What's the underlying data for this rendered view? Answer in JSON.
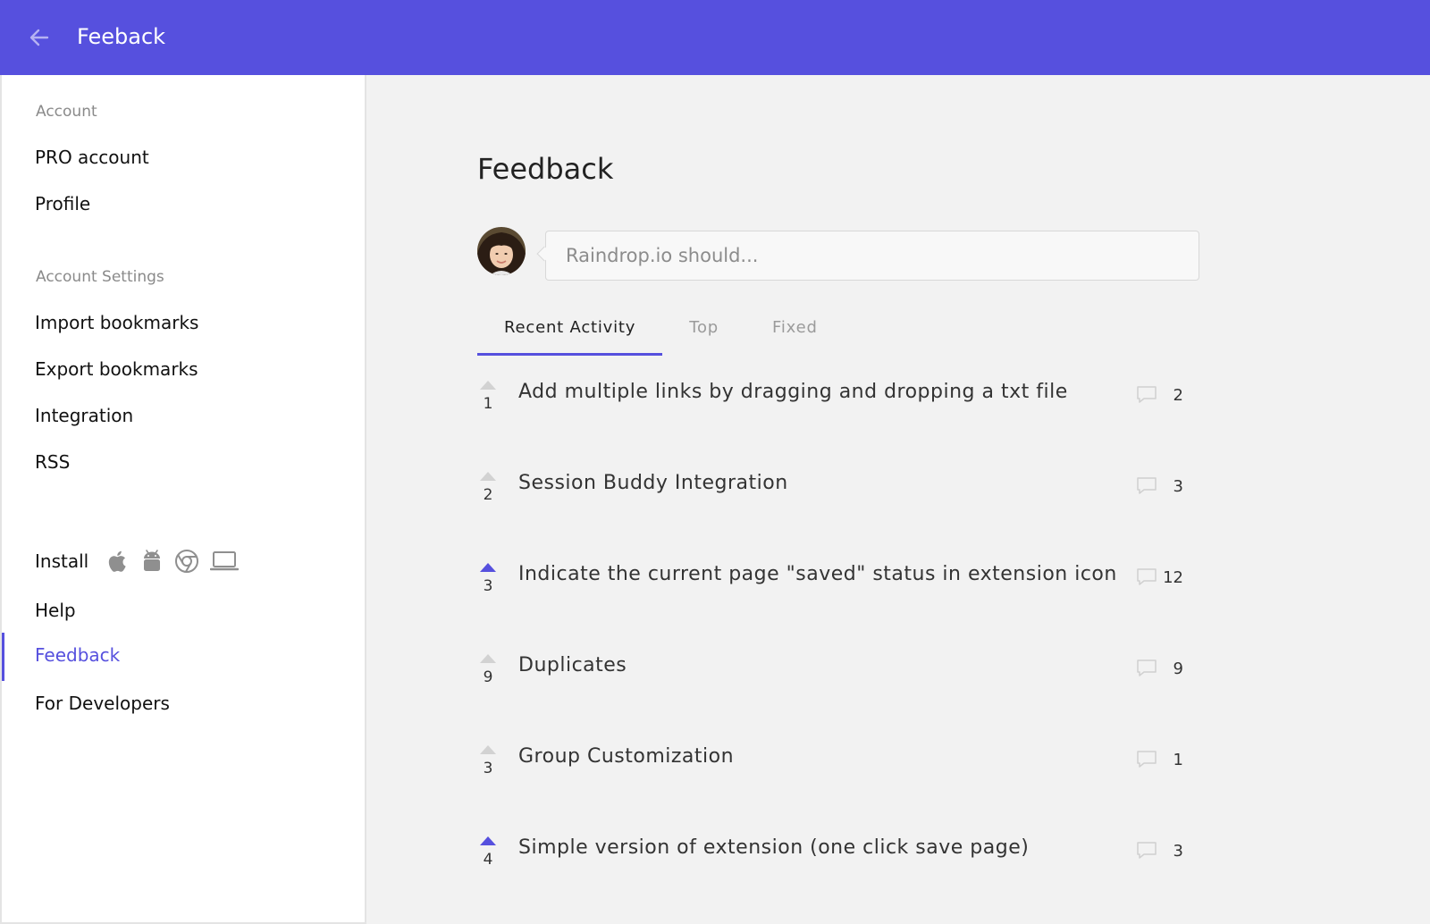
{
  "header": {
    "title": "Feeback",
    "back_icon": "arrow-left-icon",
    "accent": "#5650de"
  },
  "sidebar": {
    "sections": [
      {
        "label": "Account"
      },
      {
        "label": "Account Settings"
      }
    ],
    "items": [
      {
        "label": "PRO account"
      },
      {
        "label": "Profile"
      },
      {
        "label": "Import bookmarks"
      },
      {
        "label": "Export bookmarks"
      },
      {
        "label": "Integration"
      },
      {
        "label": "RSS"
      },
      {
        "label": "Install"
      },
      {
        "label": "Help"
      },
      {
        "label": "Feedback",
        "active": true
      },
      {
        "label": "For Developers"
      }
    ],
    "install_icons": [
      "apple-icon",
      "android-icon",
      "chrome-icon",
      "laptop-icon"
    ]
  },
  "main": {
    "title": "Feedback",
    "input": {
      "placeholder": "Raindrop.io should...",
      "value": ""
    },
    "tabs": [
      {
        "label": "Recent Activity",
        "active": true
      },
      {
        "label": "Top"
      },
      {
        "label": "Fixed"
      }
    ],
    "items": [
      {
        "votes": "1",
        "title": "Add multiple links by dragging and dropping a txt file",
        "comments": "2",
        "voted": false
      },
      {
        "votes": "2",
        "title": "Session Buddy Integration",
        "comments": "3",
        "voted": false
      },
      {
        "votes": "3",
        "title": "Indicate the current page \"saved\" status in extension icon",
        "comments": "12",
        "voted": true
      },
      {
        "votes": "9",
        "title": "Duplicates",
        "comments": "9",
        "voted": false
      },
      {
        "votes": "3",
        "title": "Group Customization",
        "comments": "1",
        "voted": false
      },
      {
        "votes": "4",
        "title": "Simple version of extension (one click save page)",
        "comments": "3",
        "voted": true
      }
    ]
  }
}
